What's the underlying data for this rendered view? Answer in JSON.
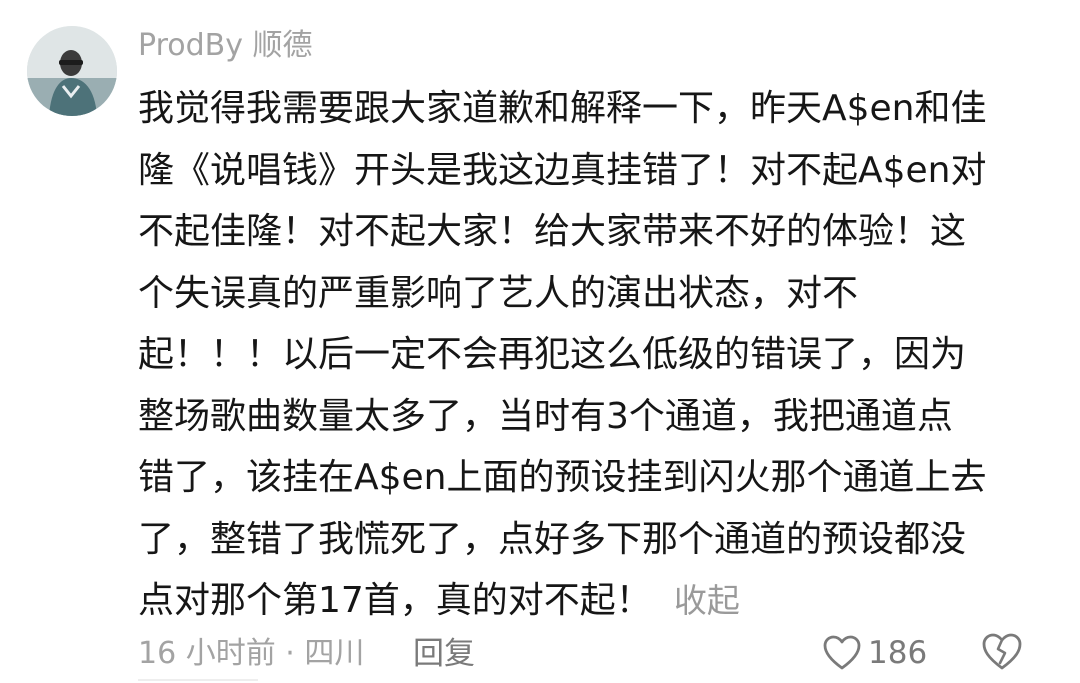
{
  "comment": {
    "username": "ProdBy 顺德",
    "lines": [
      "我觉得我需要跟大家道歉和解释一下，昨天A$en和佳",
      "隆《说唱钱》开头是我这边真挂错了！对不起A$en对",
      "不起佳隆！对不起大家！给大家带来不好的体验！这",
      "个失误真的严重影响了艺人的演出状态，对不",
      "起！！！以后一定不会再犯这么低级的错误了，因为",
      "整场歌曲数量太多了，当时有3个通道，我把通道点",
      "错了，该挂在A$en上面的预设挂到闪火那个通道上去",
      "了，整错了我慌死了，点好多下那个通道的预设都没",
      "点对那个第17首，真的对不起！"
    ],
    "collapse_label": "收起",
    "meta": "16 小时前 · 四川",
    "reply_label": "回复",
    "like_count": "186"
  },
  "icons": {
    "like": "heart-outline-icon",
    "dislike": "broken-heart-outline-icon"
  },
  "colors": {
    "text": "#161616",
    "muted": "#a3a3a3",
    "action": "#7a7a7a"
  }
}
